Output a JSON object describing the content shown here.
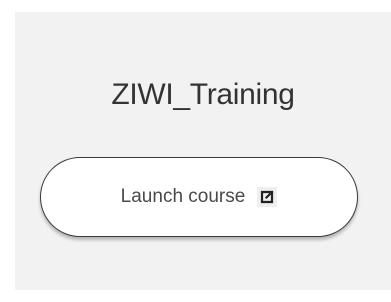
{
  "course": {
    "title": "ZIWI_Training",
    "launch_label": "Launch course",
    "launch_icon": "external-link-icon"
  },
  "colors": {
    "card_background": "#f2f2f2",
    "title_text": "#333333",
    "button_border": "#3a3a3a"
  }
}
